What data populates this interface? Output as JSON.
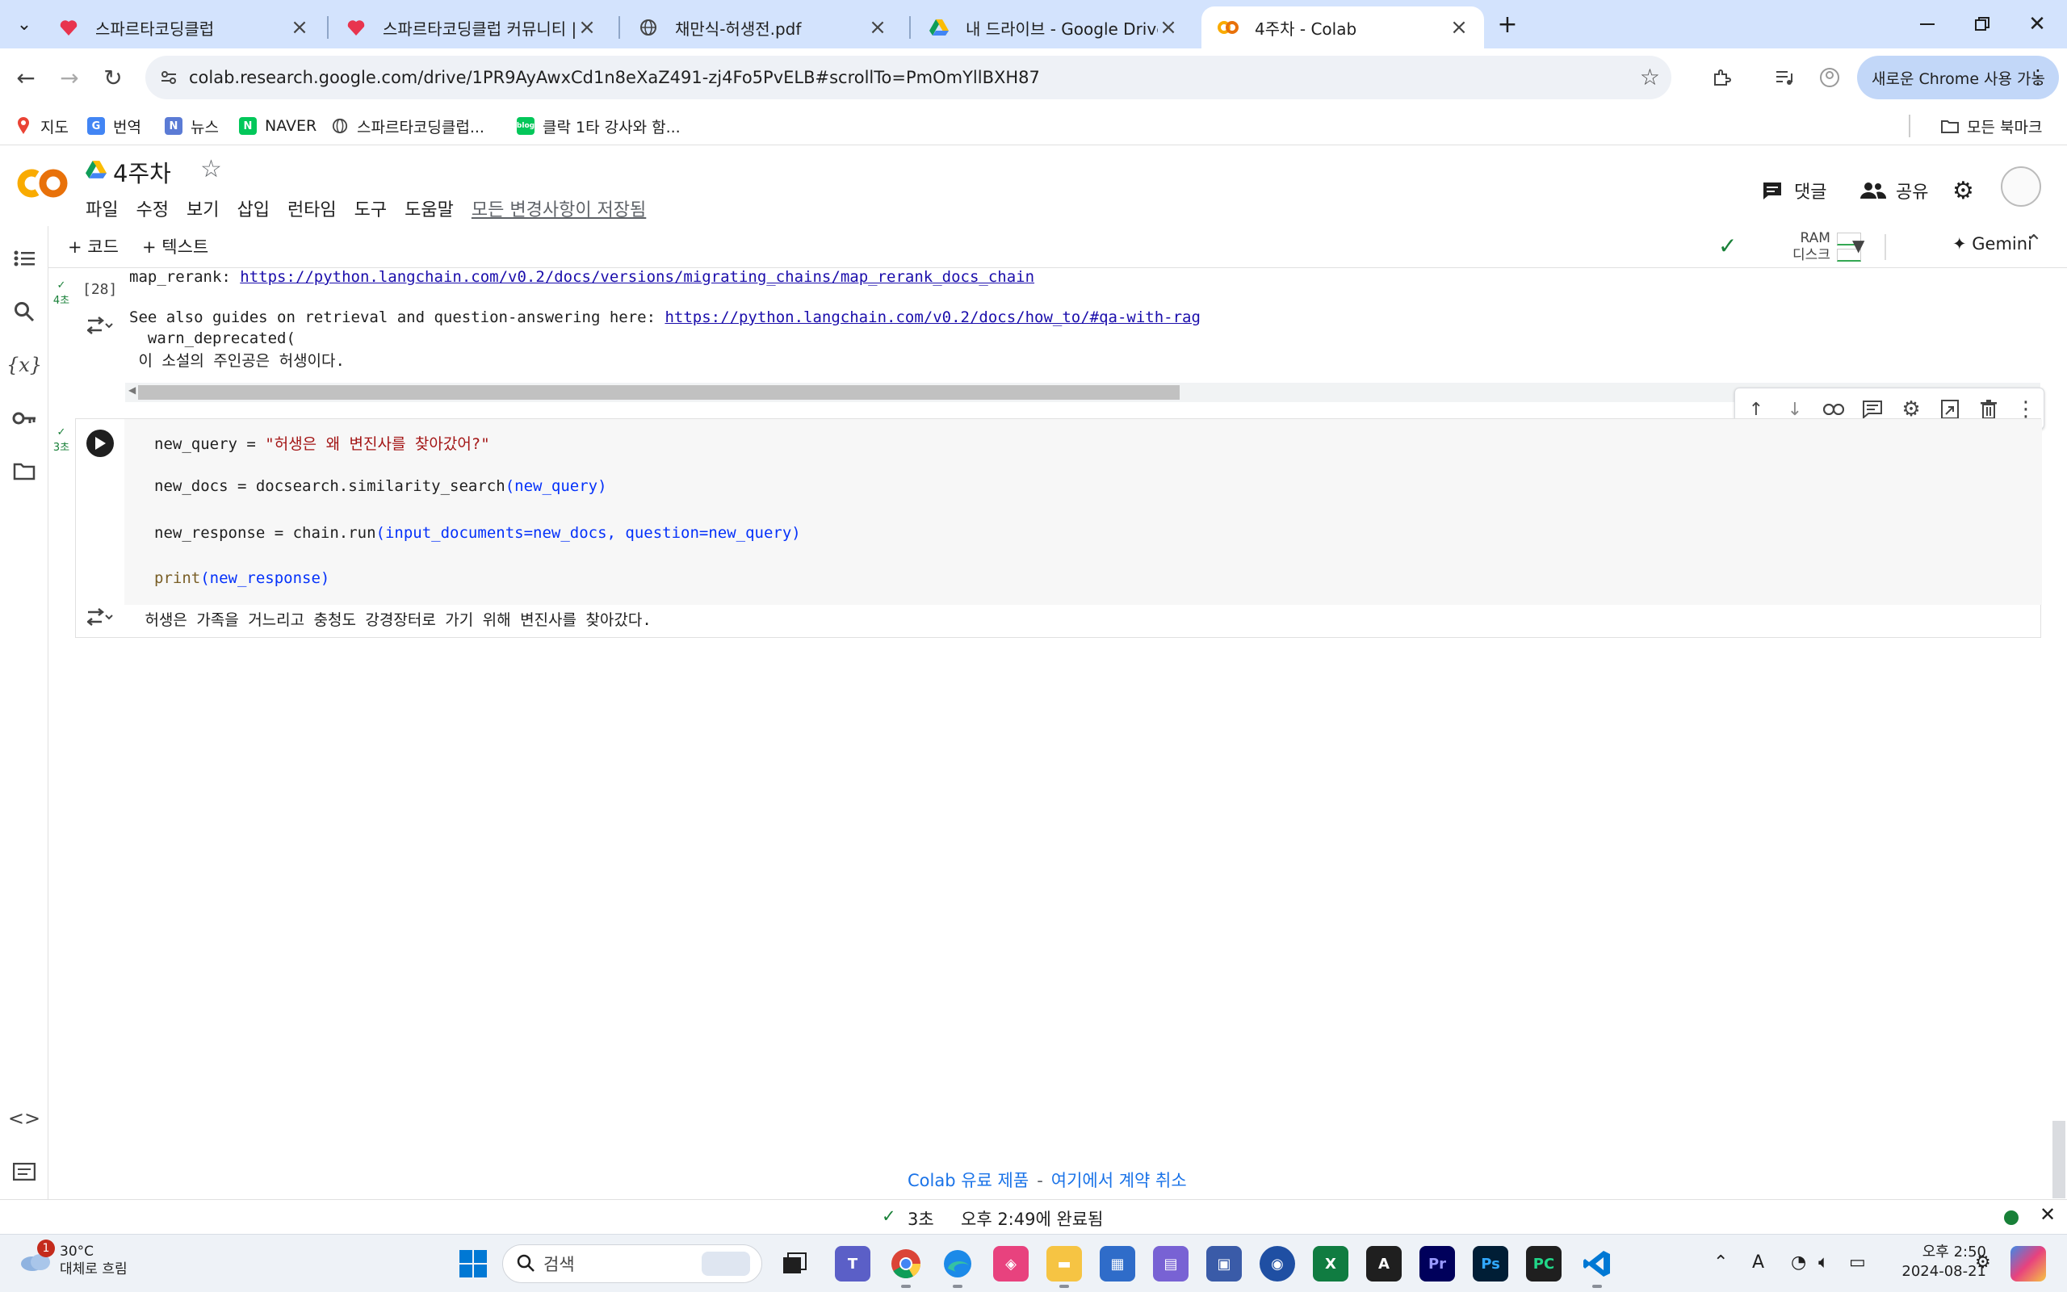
{
  "browser": {
    "tabs": [
      {
        "title": "스파르타코딩클럽",
        "icon": "sparta-heart-icon"
      },
      {
        "title": "스파르타코딩클럽 커뮤니티 | 스",
        "icon": "sparta-heart-icon"
      },
      {
        "title": "채만식-허생전.pdf",
        "icon": "globe-icon"
      },
      {
        "title": "내 드라이브 - Google Drive",
        "icon": "google-drive-icon"
      },
      {
        "title": "4주차 - Colab",
        "icon": "colab-icon",
        "active": true
      }
    ],
    "url": "colab.research.google.com/drive/1PR9AyAwxCd1n8eXaZ491-zj4Fo5PvELB#scrollTo=PmOmYllBXH87",
    "chrome_new_label": "새로운 Chrome 사용 가능",
    "bookmarks": [
      "지도",
      "번역",
      "뉴스",
      "NAVER",
      "스파르타코딩클럽...",
      "클락 1타 강사와 함..."
    ],
    "all_bookmarks": "모든 북마크"
  },
  "colab": {
    "title": "4주차",
    "menu": [
      "파일",
      "수정",
      "보기",
      "삽입",
      "런타임",
      "도구",
      "도움말"
    ],
    "saved_status": "모든 변경사항이 저장됨",
    "comment_label": "댓글",
    "share_label": "공유",
    "add_code": "+ 코드",
    "add_text": "+ 텍스트",
    "ram_label": "RAM",
    "disk_label": "디스크",
    "gemini_label": "Gemini"
  },
  "cell1": {
    "exec_time": "4초",
    "exec_count": "[28]",
    "lines": [
      {
        "prefix": "map_rerank: ",
        "link": "https://python.langchain.com/v0.2/docs/versions/migrating_chains/map_rerank_docs_chain"
      },
      {
        "prefix": "See also guides on retrieval and question-answering here: ",
        "link": "https://python.langchain.com/v0.2/docs/how_to/#qa-with-rag"
      },
      {
        "prefix": "  warn_deprecated(",
        "link": ""
      },
      {
        "prefix": " 이 소설의 주인공은 허생이다.",
        "link": ""
      }
    ]
  },
  "cell2": {
    "exec_time": "3초",
    "code": {
      "l1_var": "new_query = ",
      "l1_str": "\"허생은 왜 변진사를 찾아갔어?\"",
      "l2_a": "new_docs = docsearch.similarity_search",
      "l2_b": "(new_query)",
      "l3_a": "new_response = chain.run",
      "l3_b": "(input_documents=new_docs, question=new_query)",
      "l4_fn": "print",
      "l4_b": "(new_response)"
    },
    "output": " 허생은 가족을 거느리고 충청도 강경장터로 가기 위해 변진사를 찾아갔다."
  },
  "footer": {
    "promo_a": "Colab 유료 제품",
    "promo_dash": "-",
    "promo_b": "여기에서 계약 취소",
    "status_time": "3초",
    "status_done": "오후 2:49에 완료됨"
  },
  "taskbar": {
    "weather_temp": "30°C",
    "weather_desc": "대체로 흐림",
    "notification_count": "1",
    "search_placeholder": "검색",
    "clock_time": "오후 2:50",
    "clock_date": "2024-08-21"
  }
}
